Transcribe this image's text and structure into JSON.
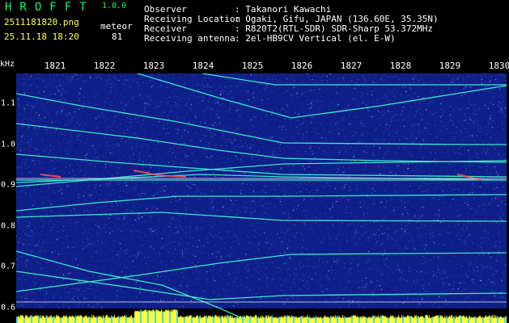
{
  "app": {
    "name": "HROFFT",
    "version": "1.0.0"
  },
  "file": {
    "name": "2511181820.png",
    "datetime": "25.11.18 18:20"
  },
  "meteor": {
    "label": "meteor",
    "count": "81"
  },
  "info": {
    "observer_label": "Observer",
    "observer_value": ": Takanori Kawachi",
    "location_label": "Receiving Location",
    "location_value": ": Ogaki, Gifu, JAPAN (136.60E, 35.35N)",
    "receiver_label": "Receiver",
    "receiver_value": ": R820T2(RTL-SDR) SDR-Sharp 53.372MHz",
    "antenna_label": "Receiving antenna",
    "antenna_value": ": 2el-HB9CV Vertical (el. E-W)"
  },
  "x_axis": {
    "ticks": [
      "1821",
      "1822",
      "1823",
      "1824",
      "1825",
      "1826",
      "1827",
      "1828",
      "1829",
      "1830"
    ]
  },
  "y_axis": {
    "unit": "kHz",
    "ticks": [
      "1.1",
      "1.0",
      "0.9",
      "0.8",
      "0.7",
      "0.6"
    ]
  },
  "colors": {
    "background": "#000000",
    "spectrogram": "#10208a",
    "signal": "#40ffd0",
    "meteor": "#ff6060",
    "bottom_band": "#ffff30"
  }
}
